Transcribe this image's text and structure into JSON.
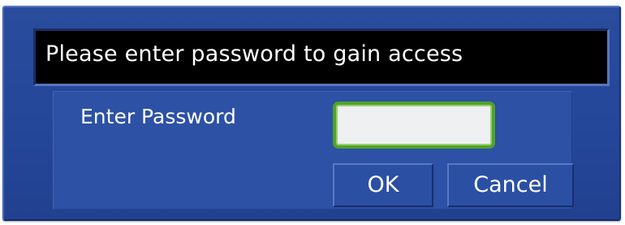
{
  "dialog": {
    "message": "Please enter password to gain access",
    "password_label": "Enter Password",
    "password_value": "",
    "ok_label": "OK",
    "cancel_label": "Cancel"
  },
  "colors": {
    "dialog_bg": "#25479a",
    "panel_bg": "#2d51a4",
    "message_bg": "#000000",
    "input_border": "#4fa32a",
    "text": "#ffffff"
  }
}
